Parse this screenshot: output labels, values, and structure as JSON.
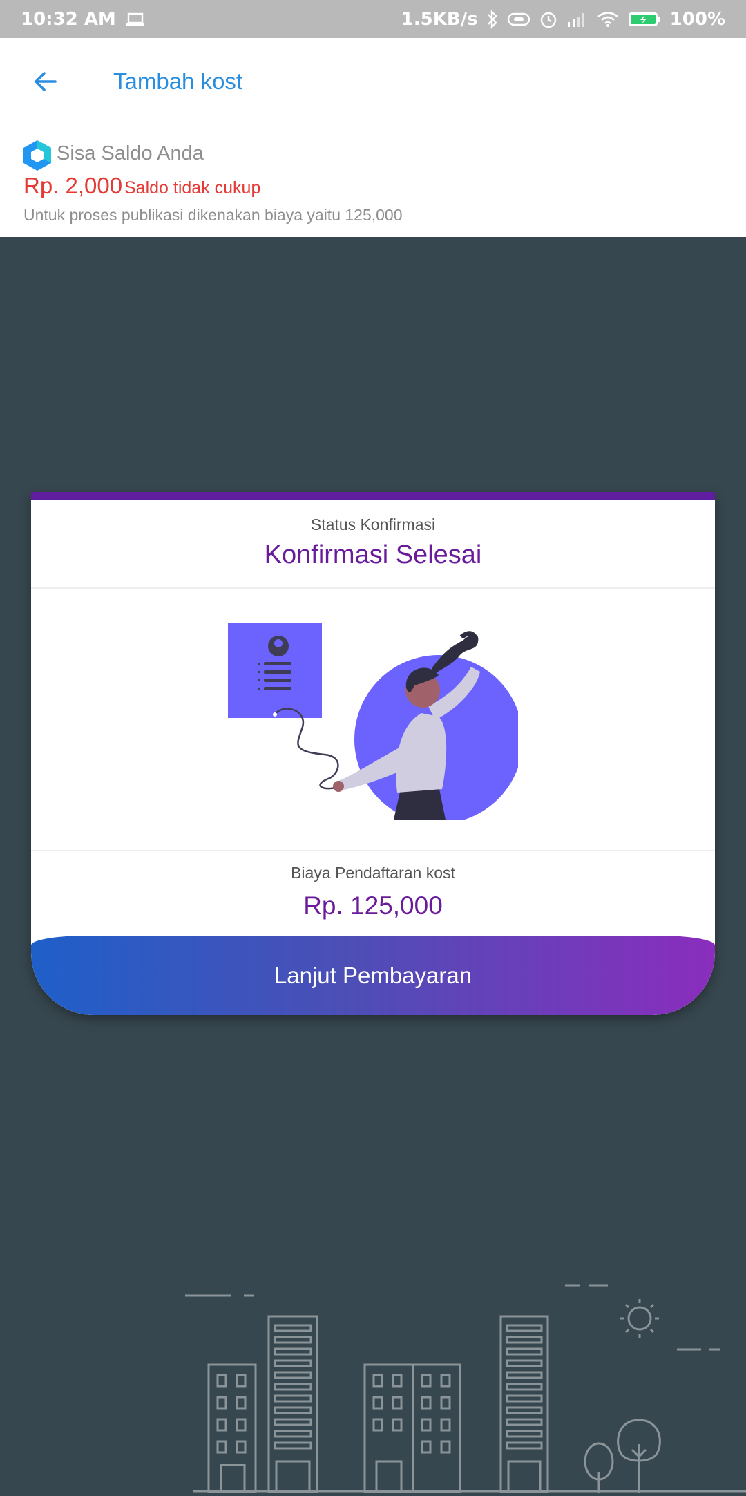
{
  "status_bar": {
    "time": "10:32 AM",
    "speed": "1.5KB/s",
    "battery": "100%",
    "icons": [
      "laptop-icon",
      "bluetooth-icon",
      "nfc-icon",
      "alarm-icon",
      "signal-icon",
      "wifi-icon",
      "battery-icon"
    ]
  },
  "app_bar": {
    "back_icon": "arrow-left-icon",
    "title": "Tambah kost"
  },
  "balance": {
    "logo": "wallet-logo-icon",
    "label": "Sisa Saldo Anda",
    "amount": "Rp. 2,000",
    "warning": "Saldo tidak cukup",
    "note": "Untuk proses publikasi dikenakan biaya yaitu 125,000"
  },
  "card": {
    "status_label": "Status Konfirmasi",
    "status_value": "Konfirmasi Selesai",
    "fee_label": "Biaya Pendaftaran kost",
    "fee_value": "Rp. 125,000",
    "button_label": "Lanjut Pembayaran"
  },
  "colors": {
    "accent_blue": "#2a8ee0",
    "error_red": "#e53935",
    "purple": "#6a1b9a",
    "background": "#37474f",
    "illustration_purple": "#6c63ff"
  }
}
